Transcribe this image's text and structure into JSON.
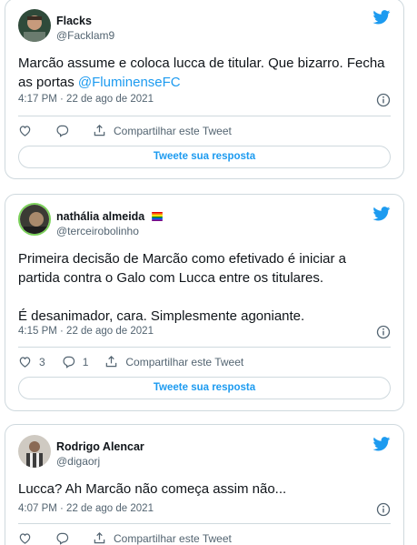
{
  "colors": {
    "accent": "#1d9bf0",
    "muted": "#536471",
    "border": "#cfd9de"
  },
  "tweets": [
    {
      "name": "Flacks",
      "handle": "@Facklam9",
      "text_before": "Marcão assume e coloca lucca de titular. Que bizarro. Fecha as portas ",
      "mention": "@FluminenseFC",
      "timestamp": "4:17 PM · 22 de ago de 2021",
      "share_label": "Compartilhar este Tweet",
      "reply_button": "Tweete sua resposta"
    },
    {
      "name": "nathália almeida",
      "handle": "@terceirobolinho",
      "text_p1": "Primeira decisão de Marcão como efetivado é iniciar a partida contra o Galo com Lucca entre os titulares.",
      "text_p2": "É desanimador, cara. Simplesmente agoniante.",
      "timestamp": "4:15 PM · 22 de ago de 2021",
      "like_count": "3",
      "reply_count": "1",
      "share_label": "Compartilhar este Tweet",
      "reply_button": "Tweete sua resposta"
    },
    {
      "name": "Rodrigo Alencar",
      "handle": "@digaorj",
      "text": "Lucca? Ah Marcão não começa assim não...",
      "timestamp": "4:07 PM · 22 de ago de 2021",
      "share_label": "Compartilhar este Tweet"
    }
  ]
}
